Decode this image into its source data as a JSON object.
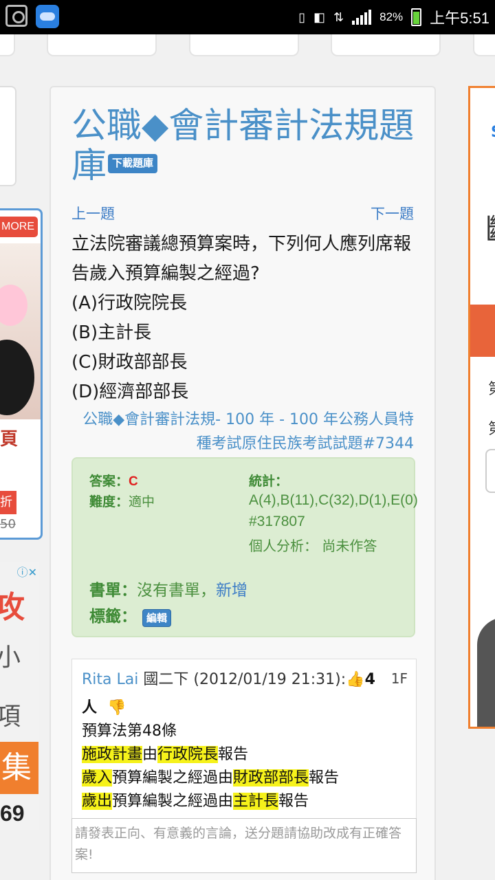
{
  "status_bar": {
    "battery": "82%",
    "time": "上午5:51"
  },
  "title": "公職◆會計審計法規題庫",
  "download_label": "下載題庫",
  "nav": {
    "prev": "上一題",
    "next": "下一題"
  },
  "question": {
    "text": "立法院審議總預算案時，下列何人應列席報告歲入預算編製之經過?",
    "options": [
      "(A)行政院院長",
      "(B)主計長",
      "(C)財政部部長",
      "(D)經濟部部長"
    ]
  },
  "source": {
    "category": "公職◆會計審計法規",
    "rest": "- 100 年 - 100 年公務人員特種考試原住民族考試試題#7344"
  },
  "answer_box": {
    "answer_label": "答案：",
    "answer_value": "C",
    "difficulty_label": "難度：",
    "difficulty_value": "適中",
    "stats_label": "統計：",
    "stats_distribution": "A(4),B(11),C(32),D(1),E(0)",
    "question_id": "#317807",
    "personal_label": "個人分析：",
    "personal_value": "尚未作答",
    "booklist_label": "書單：",
    "booklist_none": "沒有書單，",
    "booklist_add": "新增",
    "tags_label": "標籤：",
    "edit_label": "編輯"
  },
  "comment": {
    "user": "Rita Lai",
    "grade": "國二下",
    "time": "(2012/01/19 21:31):",
    "likes": "4",
    "people": "人",
    "floor": "1F",
    "lines": [
      [
        {
          "t": "預算法第48條",
          "hl": false
        }
      ],
      [
        {
          "t": "施政計畫",
          "hl": true
        },
        {
          "t": "由",
          "hl": false
        },
        {
          "t": "行政院長",
          "hl": true
        },
        {
          "t": "報告",
          "hl": false
        }
      ],
      [
        {
          "t": "歲入",
          "hl": true
        },
        {
          "t": "預算編製之經過由",
          "hl": false
        },
        {
          "t": "財政部部長",
          "hl": true
        },
        {
          "t": "報告",
          "hl": false
        }
      ],
      [
        {
          "t": "歲出",
          "hl": true
        },
        {
          "t": "預算編製之經過由",
          "hl": false
        },
        {
          "t": "主計長",
          "hl": true
        },
        {
          "t": "報告",
          "hl": false
        }
      ]
    ]
  },
  "reply_placeholder": "請發表正向、有意義的言論，送分題請協助改成有正確答案!",
  "ads": {
    "more_badge": "MORE",
    "left_red_char": "頁",
    "left_tag": "折",
    "left_price": "50",
    "left2_red": "攻",
    "left2_gray1": "小",
    "left2_gray2": "項",
    "left2_band": "集",
    "left2_num": "69",
    "right_s": "S",
    "right_char": "斷",
    "right_s1": "第",
    "right_s2": "第"
  },
  "colors": {
    "accent": "#4a90c8",
    "answer_bg": "#dcedd2",
    "highlight": "#f6f21a"
  }
}
